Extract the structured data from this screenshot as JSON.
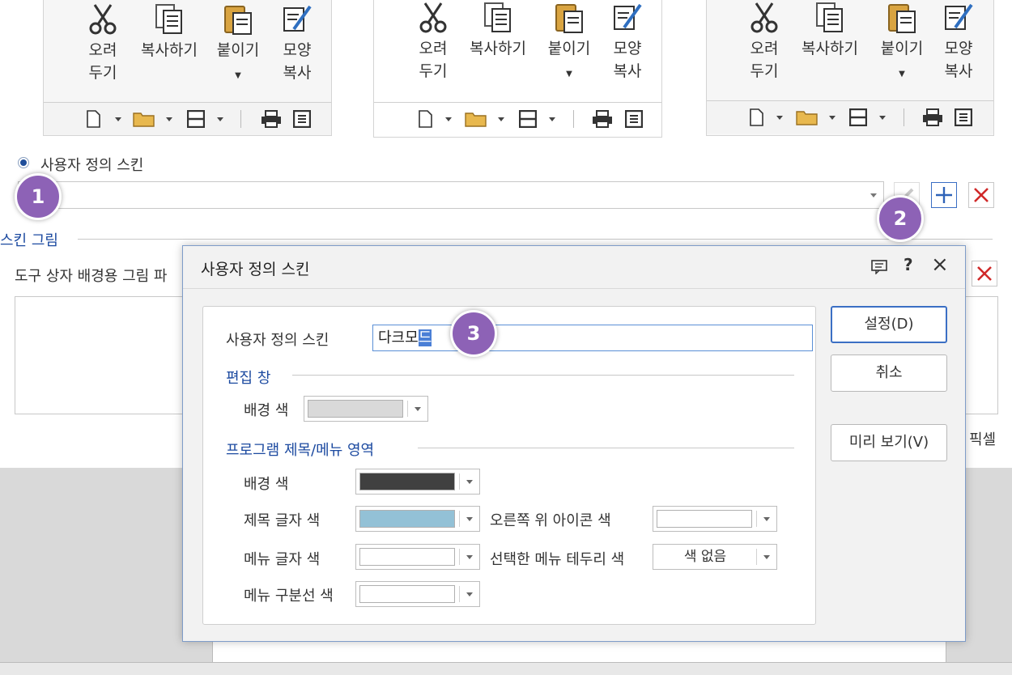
{
  "ribbon": {
    "cut_label": "오려\n두기",
    "copy_label": "복사하기",
    "paste_label": "붙이기",
    "format_painter_label": "모양\n복사"
  },
  "skin": {
    "custom_skin_radio_label": "사용자 정의 스킨",
    "skin_picture_section": "스킨 그림",
    "toolbox_bg_label": "도구 상자 배경용 그림 파",
    "pixel_label": "픽셀"
  },
  "callouts": [
    "1",
    "2",
    "3"
  ],
  "dialog": {
    "title": "사용자 정의 스킨",
    "name_label": "사용자 정의 스킨",
    "name_value_plain": "다크모",
    "name_value_selected": "드",
    "edit_window_section": "편집 창",
    "edit_bg_label": "배경 색",
    "program_section": "프로그램 제목/메뉴 영역",
    "program_bg_label": "배경 색",
    "title_text_color_label": "제목 글자 색",
    "top_right_icon_color_label": "오른쪽 위 아이콘 색",
    "menu_text_color_label": "메뉴 글자 색",
    "selected_menu_border_label": "선택한 메뉴 테두리 색",
    "selected_menu_border_value": "색 없음",
    "menu_divider_color_label": "메뉴 구분선 색",
    "ok_button": "설정(D)",
    "cancel_button": "취소",
    "preview_button": "미리 보기(V)",
    "help_glyph": "?",
    "close_glyph": "×",
    "colors": {
      "edit_bg": "#d9d9d9",
      "program_bg": "#404040",
      "title_text": "#93c1d6",
      "top_right_icon": "#ffffff",
      "menu_text": "#ffffff",
      "menu_divider": "#ffffff"
    }
  }
}
